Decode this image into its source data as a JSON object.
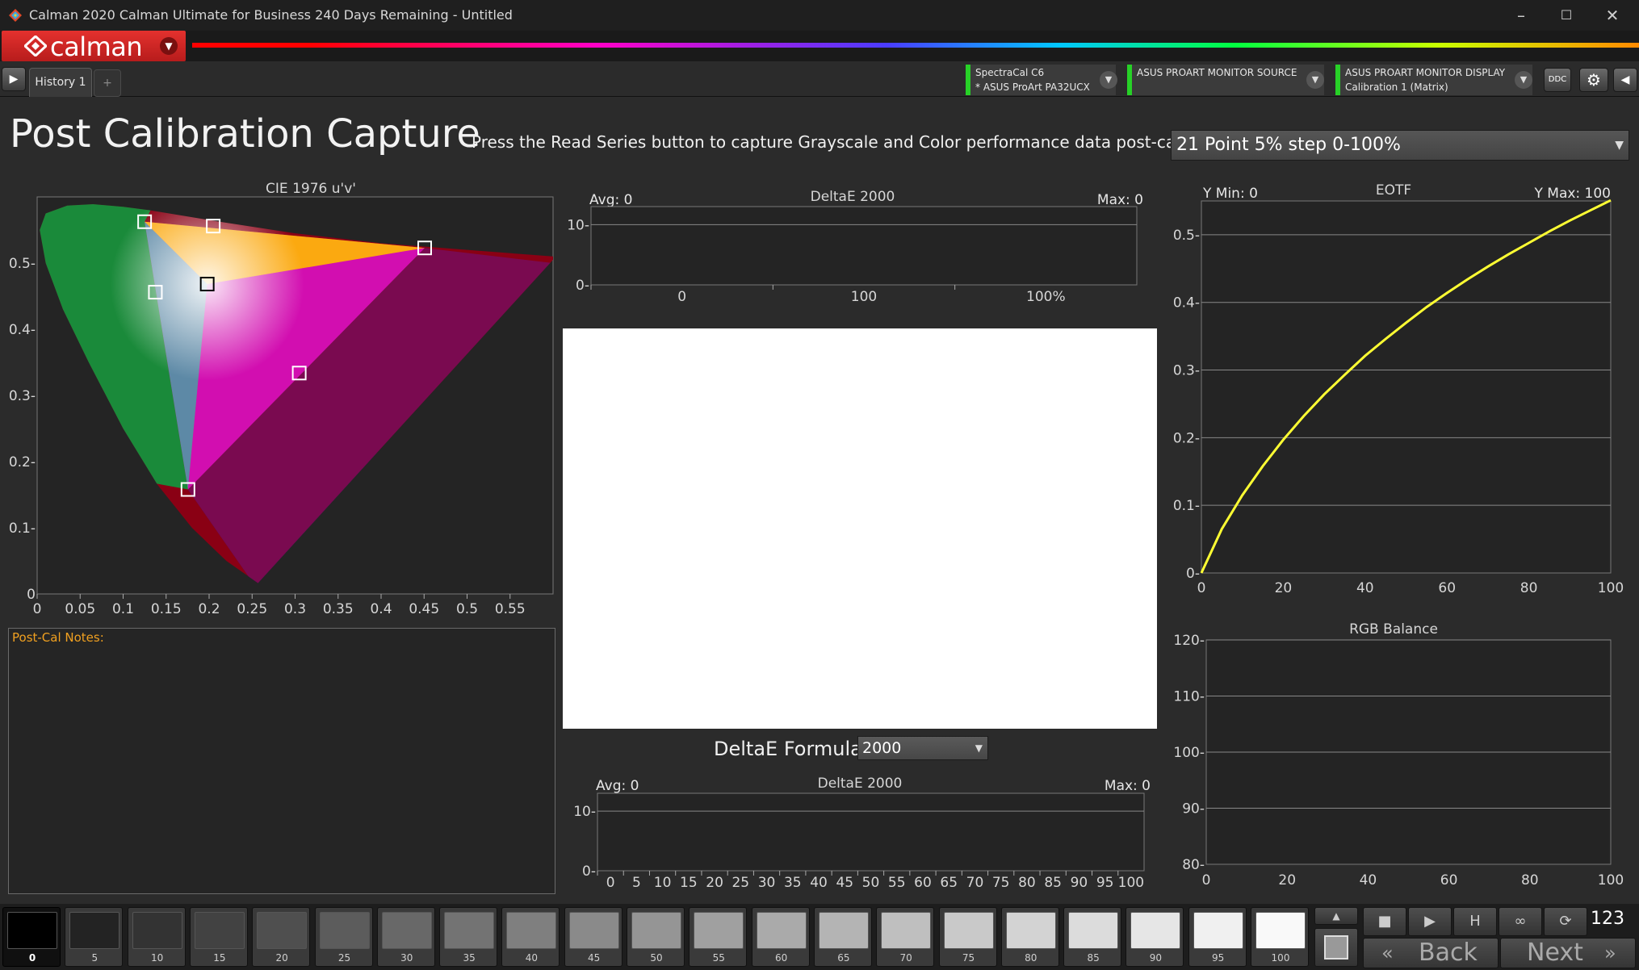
{
  "window": {
    "title": "Calman 2020 Calman Ultimate for Business 240 Days Remaining  -  Untitled",
    "controls": [
      "minimize-icon",
      "maximize-icon",
      "close-icon"
    ]
  },
  "brand": {
    "logo_text": "calman"
  },
  "tabs": {
    "items": [
      {
        "label": "History 1"
      }
    ],
    "add_label": "+"
  },
  "devices": [
    {
      "line1": "SpectraCal C6",
      "line2": "* ASUS ProArt PA32UCX"
    },
    {
      "line1": "ASUS PROART MONITOR SOURCE",
      "line2": ""
    },
    {
      "line1": "ASUS PROART MONITOR DISPLAY",
      "line2": "Calibration 1 (Matrix)"
    }
  ],
  "header": {
    "title": "Post Calibration Capture",
    "instruction": "Press the Read Series button to capture Grayscale and Color performance data post-calibration.",
    "series_select": "21 Point 5% step 0-100%"
  },
  "notes": {
    "label": "Post-Cal Notes:"
  },
  "formula": {
    "label": "DeltaE Formula",
    "value": "2000"
  },
  "colors": {
    "accent": "#e4312e",
    "device_status": "#27d127",
    "eotf_curve": "#ffff33",
    "notes_label": "#f0a020"
  },
  "chart_data": [
    {
      "type": "scatter",
      "title": "CIE 1976 u'v'",
      "xlim": [
        0,
        0.6
      ],
      "ylim": [
        0,
        0.6
      ],
      "x_ticks": [
        "0",
        "0.05",
        "0.1",
        "0.15",
        "0.2",
        "0.25",
        "0.3",
        "0.35",
        "0.4",
        "0.45",
        "0.5",
        "0.55"
      ],
      "y_ticks": [
        "0",
        "0.1-",
        "0.2-",
        "0.3-",
        "0.4-",
        "0.5-"
      ],
      "gamut_triangle": [
        [
          0.4507,
          0.5229
        ],
        [
          0.125,
          0.5625
        ],
        [
          0.1754,
          0.1579
        ]
      ],
      "targets": [
        {
          "name": "red",
          "u": 0.4507,
          "v": 0.5229
        },
        {
          "name": "green",
          "u": 0.125,
          "v": 0.5625
        },
        {
          "name": "blue",
          "u": 0.1754,
          "v": 0.1579
        },
        {
          "name": "yellow",
          "u": 0.2048,
          "v": 0.5559
        },
        {
          "name": "cyan",
          "u": 0.1375,
          "v": 0.456
        },
        {
          "name": "magenta",
          "u": 0.3048,
          "v": 0.3338
        },
        {
          "name": "white",
          "u": 0.1978,
          "v": 0.4683
        }
      ]
    },
    {
      "type": "bar",
      "title": "DeltaE 2000",
      "avg": "Avg: 0",
      "max": "Max: 0",
      "ylim": [
        0,
        13
      ],
      "y_ticks": [
        "10-",
        "0-"
      ],
      "x_ticks": [
        "0",
        "100",
        "100%"
      ],
      "values": []
    },
    {
      "type": "line",
      "title": "EOTF",
      "ymin_label": "Y Min: 0",
      "ymax_label": "Y Max: 100",
      "xlim": [
        0,
        100
      ],
      "ylim": [
        0,
        0.55
      ],
      "x_ticks": [
        "0",
        "20",
        "40",
        "60",
        "80",
        "100"
      ],
      "y_ticks": [
        "0-",
        "0.1-",
        "0.2-",
        "0.3-",
        "0.4-",
        "0.5-"
      ],
      "series": [
        {
          "x": [
            0,
            5,
            10,
            15,
            20,
            25,
            30,
            35,
            40,
            45,
            50,
            55,
            60,
            65,
            70,
            75,
            80,
            85,
            90,
            95,
            100
          ],
          "values": [
            0,
            0.065,
            0.115,
            0.158,
            0.197,
            0.232,
            0.264,
            0.293,
            0.321,
            0.346,
            0.37,
            0.393,
            0.414,
            0.434,
            0.453,
            0.471,
            0.488,
            0.505,
            0.521,
            0.536,
            0.551
          ]
        }
      ]
    },
    {
      "type": "bar",
      "title": "DeltaE 2000",
      "avg": "Avg: 0",
      "max": "Max: 0",
      "ylim": [
        0,
        13
      ],
      "y_ticks": [
        "10-",
        "0-"
      ],
      "x_ticks": [
        "0",
        "5",
        "10",
        "15",
        "20",
        "25",
        "30",
        "35",
        "40",
        "45",
        "50",
        "55",
        "60",
        "65",
        "70",
        "75",
        "80",
        "85",
        "90",
        "95",
        "100"
      ],
      "values": []
    },
    {
      "type": "line",
      "title": "RGB Balance",
      "xlim": [
        0,
        100
      ],
      "ylim": [
        80,
        120
      ],
      "x_ticks": [
        "0",
        "20",
        "40",
        "60",
        "80",
        "100"
      ],
      "y_ticks": [
        "80-",
        "90-",
        "100-",
        "110-",
        "120-"
      ],
      "series": []
    }
  ],
  "swatches": [
    {
      "label": "0",
      "level": 0
    },
    {
      "label": "5",
      "level": 5
    },
    {
      "label": "10",
      "level": 10
    },
    {
      "label": "15",
      "level": 15
    },
    {
      "label": "20",
      "level": 20
    },
    {
      "label": "25",
      "level": 25
    },
    {
      "label": "30",
      "level": 30
    },
    {
      "label": "35",
      "level": 35
    },
    {
      "label": "40",
      "level": 40
    },
    {
      "label": "45",
      "level": 45
    },
    {
      "label": "50",
      "level": 50
    },
    {
      "label": "55",
      "level": 55
    },
    {
      "label": "60",
      "level": 60
    },
    {
      "label": "65",
      "level": 65
    },
    {
      "label": "70",
      "level": 70
    },
    {
      "label": "75",
      "level": 75
    },
    {
      "label": "80",
      "level": 80
    },
    {
      "label": "85",
      "level": 85
    },
    {
      "label": "90",
      "level": 90
    },
    {
      "label": "95",
      "level": 95
    },
    {
      "label": "100",
      "level": 100
    }
  ],
  "navigation": {
    "back_label": "Back",
    "next_label": "Next",
    "counter": "123"
  }
}
